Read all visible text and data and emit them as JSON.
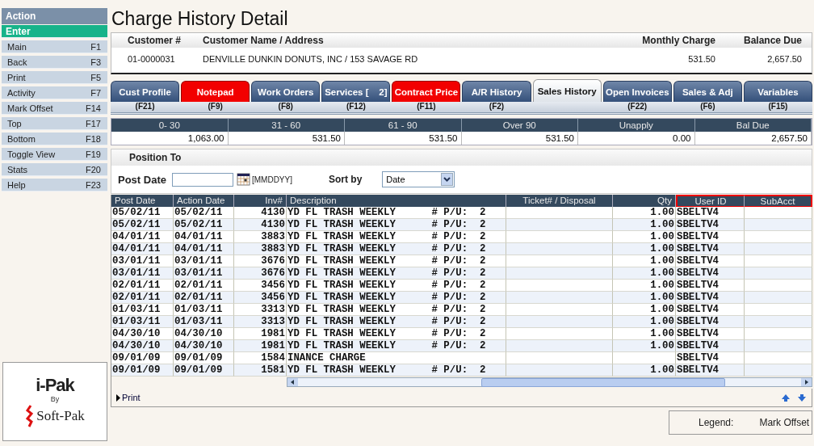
{
  "sidebar": {
    "header": "Action",
    "items": [
      {
        "label": "Enter",
        "selected": true
      },
      {
        "label": "Main",
        "key": "F1",
        "selected": false
      },
      {
        "label": "Back",
        "key": "F3",
        "selected": false
      },
      {
        "label": "Print",
        "key": "F5",
        "selected": false
      },
      {
        "label": "Activity",
        "key": "F7",
        "selected": false
      },
      {
        "label": "Mark Offset",
        "key": "F14",
        "selected": false
      },
      {
        "label": "Top",
        "key": "F17",
        "selected": false
      },
      {
        "label": "Bottom",
        "key": "F18",
        "selected": false
      },
      {
        "label": "Toggle View",
        "key": "F19",
        "selected": false
      },
      {
        "label": "Stats",
        "key": "F20",
        "selected": false
      },
      {
        "label": "Help",
        "key": "F23",
        "selected": false
      }
    ]
  },
  "logo": {
    "brand": "i-Pak",
    "by": "By",
    "maker": "Soft-Pak"
  },
  "title": "Charge History Detail",
  "customer": {
    "number_label": "Customer #",
    "name_label": "Customer Name / Address",
    "charge_label": "Monthly Charge",
    "balance_label": "Balance Due",
    "number": "01-0000031",
    "name": "DENVILLE DUNKIN DONUTS, INC  /  153 SAVAGE RD",
    "charge": "531.50",
    "balance": "2,657.50"
  },
  "tabs": [
    {
      "label": "Cust Profile",
      "fkey": "(F21)",
      "alert": false,
      "selected": false
    },
    {
      "label": "Notepad",
      "fkey": "(F9)",
      "alert": true,
      "selected": false
    },
    {
      "label": "Work Orders",
      "fkey": "(F8)",
      "alert": false,
      "selected": false
    },
    {
      "label": "Services [    2]",
      "fkey": "(F12)",
      "alert": false,
      "selected": false
    },
    {
      "label": "Contract Price",
      "fkey": "(F11)",
      "alert": true,
      "selected": false
    },
    {
      "label": "A/R History",
      "fkey": "(F2)",
      "alert": false,
      "selected": false
    },
    {
      "label": "Sales History",
      "alert": false,
      "selected": true
    },
    {
      "label": "Open Invoices",
      "fkey": "(F22)",
      "alert": false,
      "selected": false
    },
    {
      "label": "Sales & Adj",
      "fkey": "(F6)",
      "alert": false,
      "selected": false
    },
    {
      "label": "Variables",
      "fkey": "(F15)",
      "alert": false,
      "selected": false
    }
  ],
  "aging": [
    {
      "label": "0- 30",
      "value": "1,063.00"
    },
    {
      "label": "31 - 60",
      "value": "531.50"
    },
    {
      "label": "61 - 90",
      "value": "531.50"
    },
    {
      "label": "Over 90",
      "value": "531.50"
    },
    {
      "label": "Unapply",
      "value": "0.00"
    },
    {
      "label": "Bal Due",
      "value": "2,657.50"
    }
  ],
  "position": {
    "heading": "Position To",
    "date_label": "Post Date",
    "date_hint": "[MMDDYY]",
    "sort_label": "Sort by",
    "sort_value": "Date"
  },
  "grid": {
    "columns": [
      {
        "label": "Post Date",
        "boxed": false
      },
      {
        "label": "Action Date",
        "boxed": false
      },
      {
        "label": "Inv#",
        "boxed": false
      },
      {
        "label": "Description",
        "boxed": false
      },
      {
        "label": "Ticket# / Disposal",
        "boxed": false
      },
      {
        "label": "Qty",
        "boxed": false
      },
      {
        "label": "User ID",
        "boxed": true
      },
      {
        "label": "SubAcct",
        "boxed": true
      }
    ],
    "rows": [
      {
        "post": "05/02/11",
        "action": "05/02/11",
        "inv": "4130",
        "desc": "YD FL TRASH WEEKLY      # P/U:  2",
        "qty": "1.00",
        "user": "SBELTV4"
      },
      {
        "post": "05/02/11",
        "action": "05/02/11",
        "inv": "4130",
        "desc": "YD FL TRASH WEEKLY      # P/U:  2",
        "qty": "1.00",
        "user": "SBELTV4"
      },
      {
        "post": "04/01/11",
        "action": "04/01/11",
        "inv": "3883",
        "desc": "YD FL TRASH WEEKLY      # P/U:  2",
        "qty": "1.00",
        "user": "SBELTV4"
      },
      {
        "post": "04/01/11",
        "action": "04/01/11",
        "inv": "3883",
        "desc": "YD FL TRASH WEEKLY      # P/U:  2",
        "qty": "1.00",
        "user": "SBELTV4"
      },
      {
        "post": "03/01/11",
        "action": "03/01/11",
        "inv": "3676",
        "desc": "YD FL TRASH WEEKLY      # P/U:  2",
        "qty": "1.00",
        "user": "SBELTV4"
      },
      {
        "post": "03/01/11",
        "action": "03/01/11",
        "inv": "3676",
        "desc": "YD FL TRASH WEEKLY      # P/U:  2",
        "qty": "1.00",
        "user": "SBELTV4"
      },
      {
        "post": "02/01/11",
        "action": "02/01/11",
        "inv": "3456",
        "desc": "YD FL TRASH WEEKLY      # P/U:  2",
        "qty": "1.00",
        "user": "SBELTV4"
      },
      {
        "post": "02/01/11",
        "action": "02/01/11",
        "inv": "3456",
        "desc": "YD FL TRASH WEEKLY      # P/U:  2",
        "qty": "1.00",
        "user": "SBELTV4"
      },
      {
        "post": "01/03/11",
        "action": "01/03/11",
        "inv": "3313",
        "desc": "YD FL TRASH WEEKLY      # P/U:  2",
        "qty": "1.00",
        "user": "SBELTV4"
      },
      {
        "post": "01/03/11",
        "action": "01/03/11",
        "inv": "3313",
        "desc": "YD FL TRASH WEEKLY      # P/U:  2",
        "qty": "1.00",
        "user": "SBELTV4"
      },
      {
        "post": "04/30/10",
        "action": "04/30/10",
        "inv": "1981",
        "desc": "YD FL TRASH WEEKLY      # P/U:  2",
        "qty": "1.00",
        "user": "SBELTV4"
      },
      {
        "post": "04/30/10",
        "action": "04/30/10",
        "inv": "1981",
        "desc": "YD FL TRASH WEEKLY      # P/U:  2",
        "qty": "1.00",
        "user": "SBELTV4"
      },
      {
        "post": "09/01/09",
        "action": "09/01/09",
        "inv": "1584",
        "desc": "INANCE CHARGE",
        "user": "SBELTV4"
      },
      {
        "post": "09/01/09",
        "action": "09/01/09",
        "inv": "1581",
        "desc": "YD FL TRASH WEEKLY      # P/U:  2",
        "qty": "1.00",
        "user": "SBELTV4"
      }
    ]
  },
  "print_link": "Print",
  "legend": {
    "label": "Legend:",
    "value": "Mark Offset"
  }
}
